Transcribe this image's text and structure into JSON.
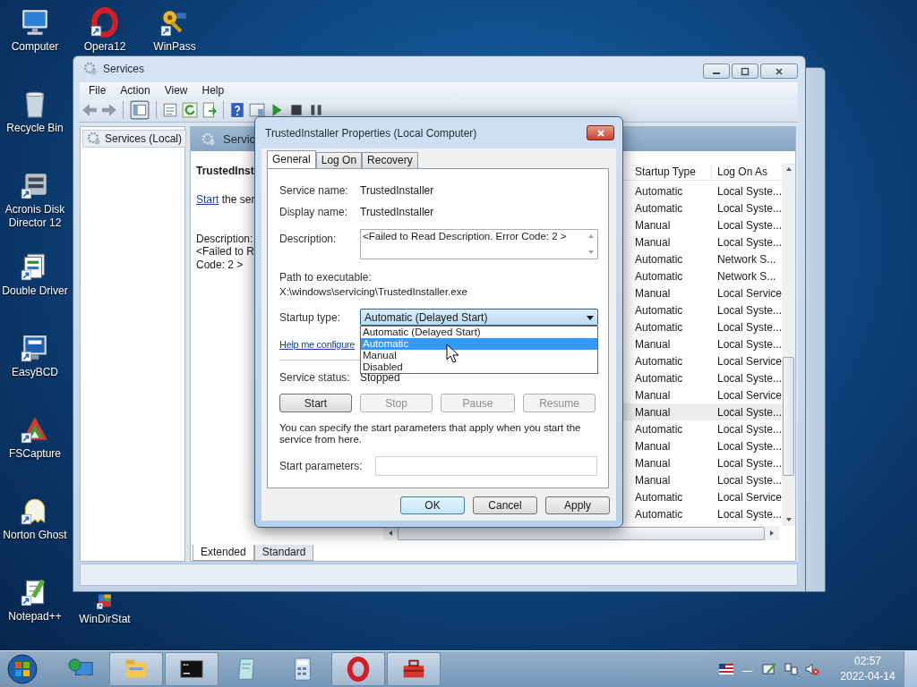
{
  "desktop_icons": [
    {
      "label": "Computer",
      "kind": "computer"
    },
    {
      "label": "Opera12",
      "kind": "opera"
    },
    {
      "label": "WinPass",
      "kind": "key"
    },
    {
      "label": "Recycle Bin",
      "kind": "recycle"
    },
    {
      "label": "Acronis Disk Director 12",
      "kind": "disk"
    },
    {
      "label": "Double Driver",
      "kind": "driver"
    },
    {
      "label": "EasyBCD",
      "kind": "easybcd"
    },
    {
      "label": "FSCapture",
      "kind": "fscapture"
    },
    {
      "label": "Norton Ghost",
      "kind": "ghost"
    },
    {
      "label": "Notepad++",
      "kind": "notepad"
    },
    {
      "label": "WinDirStat",
      "kind": "windirstat"
    }
  ],
  "services_window": {
    "title": "Services",
    "menu": [
      "File",
      "Action",
      "View",
      "Help"
    ],
    "tree": [
      {
        "label": "Services (Local)",
        "selected": true
      }
    ],
    "pane_header": "Servic",
    "details": {
      "title": "TrustedInst",
      "start_link": "Start",
      "start_rest": "the ser",
      "description_label": "Description:",
      "description_lines": [
        "<Failed to R",
        "Code: 2 >"
      ]
    },
    "columns": [
      "Startup Type",
      "Log On As"
    ],
    "rows": [
      {
        "startup_type": "Automatic",
        "log_on_as": "Local Syste...",
        "selected": false
      },
      {
        "startup_type": "Automatic",
        "log_on_as": "Local Syste...",
        "selected": false
      },
      {
        "startup_type": "Manual",
        "log_on_as": "Local Syste...",
        "selected": false
      },
      {
        "startup_type": "Manual",
        "log_on_as": "Local Syste...",
        "selected": false
      },
      {
        "startup_type": "Automatic",
        "log_on_as": "Network S...",
        "selected": false
      },
      {
        "startup_type": "Automatic",
        "log_on_as": "Network S...",
        "selected": false
      },
      {
        "startup_type": "Manual",
        "log_on_as": "Local Service",
        "selected": false
      },
      {
        "startup_type": "Automatic",
        "log_on_as": "Local Syste...",
        "selected": false
      },
      {
        "startup_type": "Automatic",
        "log_on_as": "Local Syste...",
        "selected": false
      },
      {
        "startup_type": "Manual",
        "log_on_as": "Local Syste...",
        "selected": false
      },
      {
        "startup_type": "Automatic",
        "log_on_as": "Local Service",
        "selected": false
      },
      {
        "startup_type": "Automatic",
        "log_on_as": "Local Syste...",
        "selected": false
      },
      {
        "startup_type": "Manual",
        "log_on_as": "Local Service",
        "selected": false
      },
      {
        "startup_type": "Manual",
        "log_on_as": "Local Syste...",
        "selected": true
      },
      {
        "startup_type": "Automatic",
        "log_on_as": "Local Syste...",
        "selected": false
      },
      {
        "startup_type": "Manual",
        "log_on_as": "Local Syste...",
        "selected": false
      },
      {
        "startup_type": "Manual",
        "log_on_as": "Local Syste...",
        "selected": false
      },
      {
        "startup_type": "Manual",
        "log_on_as": "Local Syste...",
        "selected": false
      },
      {
        "startup_type": "Automatic",
        "log_on_as": "Local Service",
        "selected": false
      },
      {
        "startup_type": "Automatic",
        "log_on_as": "Local Syste...",
        "selected": false
      }
    ],
    "view_tabs": [
      {
        "label": "Extended",
        "selected": true
      },
      {
        "label": "Standard",
        "selected": false
      }
    ]
  },
  "dialog": {
    "title": "TrustedInstaller Properties (Local Computer)",
    "tabs": [
      {
        "label": "General",
        "selected": true
      },
      {
        "label": "Log On",
        "selected": false
      },
      {
        "label": "Recovery",
        "selected": false
      }
    ],
    "service_name": {
      "label": "Service name:",
      "value": "TrustedInstaller"
    },
    "display_name": {
      "label": "Display name:",
      "value": "TrustedInstaller"
    },
    "description": {
      "label": "Description:",
      "value": "<Failed to Read Description. Error Code: 2 >"
    },
    "path": {
      "label": "Path to executable:",
      "value": "X:\\windows\\servicing\\TrustedInstaller.exe"
    },
    "startup_type": {
      "label": "Startup type:",
      "value": "Automatic (Delayed Start)",
      "expanded": true,
      "options": [
        {
          "label": "Automatic (Delayed Start)",
          "highlighted": false
        },
        {
          "label": "Automatic",
          "highlighted": true
        },
        {
          "label": "Manual",
          "highlighted": false
        },
        {
          "label": "Disabled",
          "highlighted": false
        }
      ]
    },
    "help_link": "Help me configure",
    "service_status": {
      "label": "Service status:",
      "value": "Stopped"
    },
    "control_buttons": [
      {
        "label": "Start",
        "disabled": false
      },
      {
        "label": "Stop",
        "disabled": true
      },
      {
        "label": "Pause",
        "disabled": true
      },
      {
        "label": "Resume",
        "disabled": true
      }
    ],
    "note": "You can specify the start parameters that apply when you start the service from here.",
    "start_parameters": {
      "label": "Start parameters:"
    },
    "buttons": [
      {
        "label": "OK",
        "default": true
      },
      {
        "label": "Cancel",
        "default": false
      },
      {
        "label": "Apply",
        "default": false
      }
    ]
  },
  "taskbar": {
    "apps": [
      {
        "kind": "network",
        "active": false
      },
      {
        "kind": "explorer",
        "active": true
      },
      {
        "kind": "console",
        "active": true
      },
      {
        "kind": "notepad",
        "active": false
      },
      {
        "kind": "calculator",
        "active": false
      },
      {
        "kind": "opera",
        "active": true
      },
      {
        "kind": "toolbox",
        "active": true
      }
    ],
    "time": "02:57",
    "date": "2022-04-14"
  }
}
